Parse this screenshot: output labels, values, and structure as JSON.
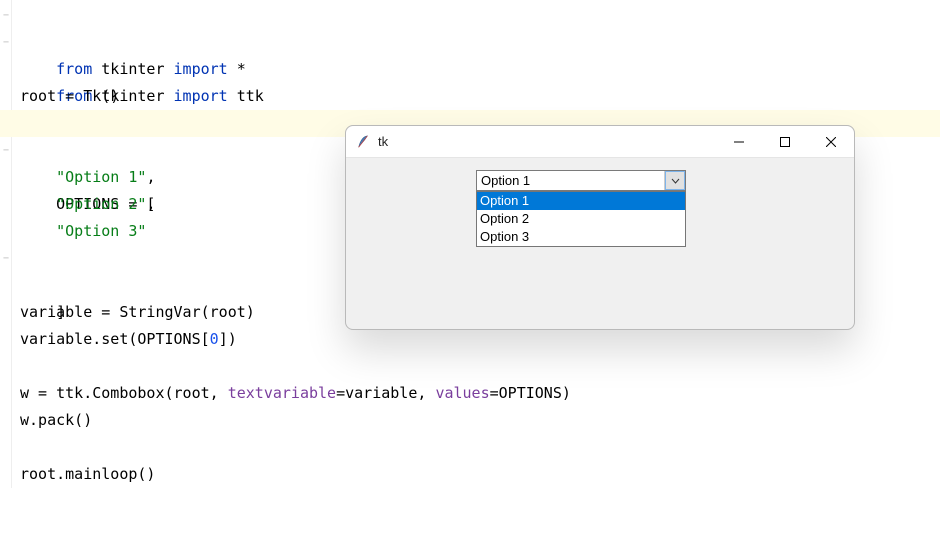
{
  "code": {
    "l1a": "from",
    "l1b": " tkinter ",
    "l1c": "import",
    "l1d": " *",
    "l2a": "from",
    "l2b": " tkinter ",
    "l2c": "import",
    "l2d": " ttk",
    "l4": "root = Tk()",
    "l6": "OPTIONS = [",
    "l7a": "    ",
    "l7b": "\"Option 1\"",
    "l7c": ",",
    "l8a": "    ",
    "l8b": "\"Option 2\"",
    "l8c": ",",
    "l9a": "    ",
    "l9b": "\"Option 3\"",
    "l10": "]",
    "l12": "variable = StringVar(root)",
    "l13a": "variable.set(OPTIONS[",
    "l13b": "0",
    "l13c": "])",
    "l15a": "w = ttk.Combobox(root, ",
    "l15b": "textvariable",
    "l15c": "=variable, ",
    "l15d": "values",
    "l15e": "=OPTIONS)",
    "l16": "w.pack()",
    "l18": "root.mainloop()"
  },
  "window": {
    "title": "tk",
    "combobox_value": "Option 1",
    "dropdown": [
      "Option 1",
      "Option 2",
      "Option 3"
    ],
    "selected_index": 0
  }
}
